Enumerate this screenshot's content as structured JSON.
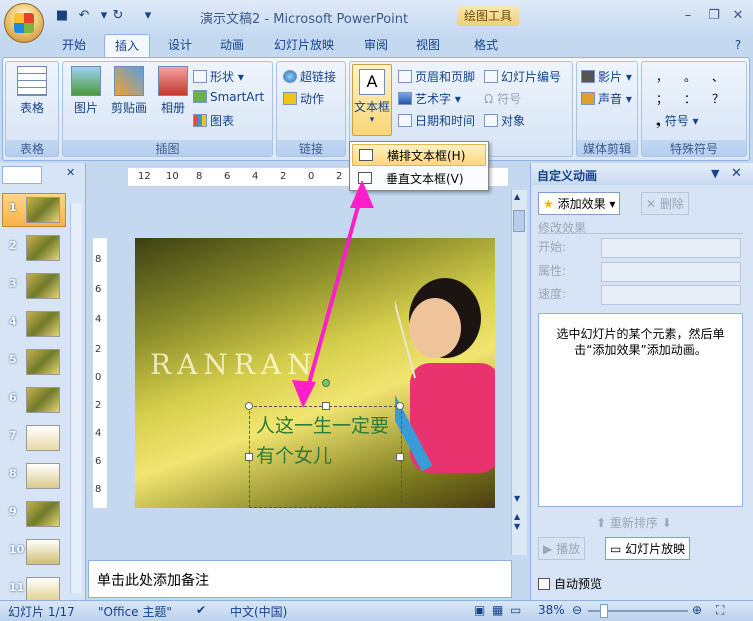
{
  "window": {
    "title": "演示文稿2 - Microsoft PowerPoint",
    "contextual_tab": "绘图工具"
  },
  "tabs": [
    "开始",
    "插入",
    "设计",
    "动画",
    "幻灯片放映",
    "审阅",
    "视图",
    "格式"
  ],
  "active_tab": "插入",
  "ribbon": {
    "groups": {
      "table": {
        "label": "表格",
        "button": "表格"
      },
      "illustrations": {
        "label": "插图",
        "picture": "图片",
        "clipart": "剪贴画",
        "album": "相册",
        "shapes": "形状",
        "smartart": "SmartArt",
        "chart": "图表"
      },
      "links": {
        "label": "链接",
        "hyperlink": "超链接",
        "action": "动作"
      },
      "text": {
        "textbox": "文本框",
        "header_footer": "页眉和页脚",
        "wordart": "艺术字",
        "datetime": "日期和时间",
        "slide_number": "幻灯片编号",
        "symbol": "符号",
        "object": "对象"
      },
      "media": {
        "label": "媒体剪辑",
        "movie": "影片",
        "sound": "声音"
      },
      "special": {
        "label": "特殊符号",
        "symbols": [
          "，",
          "。",
          "、",
          "；",
          "：",
          "？"
        ],
        "symbol_btn": "符号"
      }
    }
  },
  "dropdown": {
    "items": [
      "横排文本框(H)",
      "垂直文本框(V)"
    ]
  },
  "slides": {
    "numbers": [
      "1",
      "2",
      "3",
      "4",
      "5",
      "6",
      "7",
      "8",
      "9",
      "10",
      "11"
    ]
  },
  "rulers": {
    "horizontal": [
      "12",
      "10",
      "8",
      "6",
      "4",
      "2",
      "0",
      "2"
    ],
    "vertical": [
      "8",
      "6",
      "4",
      "2",
      "0",
      "2",
      "4",
      "6",
      "8"
    ]
  },
  "slide": {
    "title_text": "RANRAN",
    "textbox_text": "人这一生一定要有个女儿"
  },
  "notes": {
    "placeholder": "单击此处添加备注"
  },
  "custom_animation": {
    "title": "自定义动画",
    "add_effect": "添加效果",
    "delete": "删除",
    "modify_header": "修改效果",
    "start_label": "开始:",
    "property_label": "属性:",
    "speed_label": "速度:",
    "info": "选中幻灯片的某个元素，然后单击“添加效果”添加动画。",
    "reorder": "重新排序",
    "play": "播放",
    "slideshow": "幻灯片放映",
    "autopreview": "自动预览"
  },
  "status": {
    "slide": "幻灯片 1/17",
    "theme": "\"Office 主题\"",
    "language": "中文(中国)",
    "zoom": "38%"
  },
  "colors": {
    "accent_arrow": "#ff1fc8",
    "ribbon_bg": "#d9e7f7",
    "highlight": "#ffd97a"
  }
}
